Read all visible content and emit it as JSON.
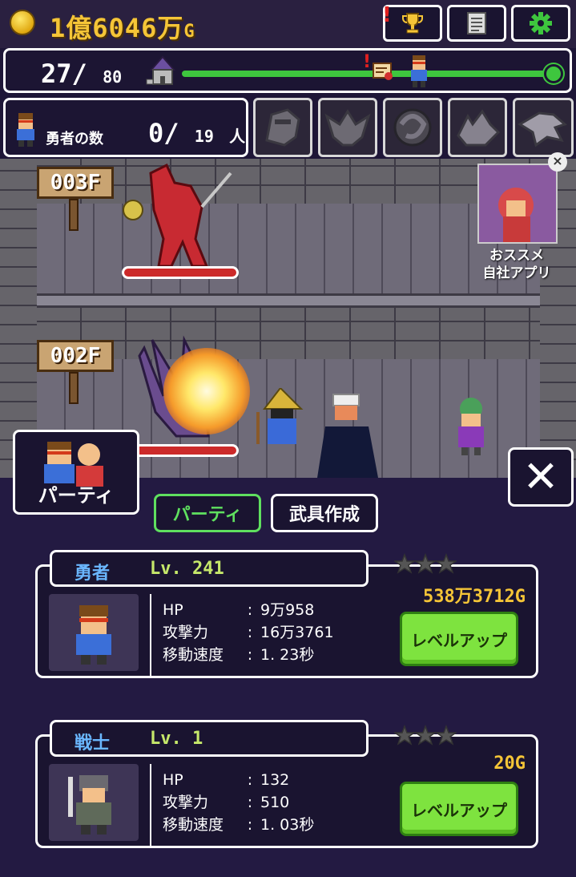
{
  "hud": {
    "gold": "1億6046万",
    "gold_unit": "G",
    "buttons": [
      "trophy",
      "notes",
      "settings"
    ]
  },
  "progress": {
    "current_floor": "27",
    "slash": "/",
    "total_floors": "80",
    "fraction": 0.34
  },
  "heroes": {
    "label": "勇者の数",
    "count": "0",
    "slash": "/",
    "total": "19",
    "unit": "人"
  },
  "boss_icons": [
    "armored-knight-icon",
    "gargoyle-icon",
    "serpent-icon",
    "wolf-icon",
    "eagle-icon"
  ],
  "dungeon": {
    "floors": [
      {
        "label": "003F",
        "enemy_hp": 1.0
      },
      {
        "label": "002F",
        "enemy_hp": 1.0
      }
    ]
  },
  "ad": {
    "label_line1": "おススメ",
    "label_line2": "自社アプリ",
    "close": "×"
  },
  "party_tab": {
    "label": "パーティ"
  },
  "close_button": {
    "label": "✕"
  },
  "tabs": [
    {
      "label": "パーティ",
      "active": true
    },
    {
      "label": "武具作成",
      "active": false
    }
  ],
  "units": [
    {
      "name": "勇者",
      "level": "Lv. 241",
      "cost": "538万3712G",
      "stars": 3,
      "stats": [
        {
          "key": "HP",
          "value": "9万958"
        },
        {
          "key": "攻撃力",
          "value": "16万3761"
        },
        {
          "key": "移動速度",
          "value": "1. 23秒"
        }
      ],
      "button": "レベルアップ"
    },
    {
      "name": "戦士",
      "level": "Lv. 1",
      "cost": "20G",
      "stars": 3,
      "stats": [
        {
          "key": "HP",
          "value": "132"
        },
        {
          "key": "攻撃力",
          "value": "510"
        },
        {
          "key": "移動速度",
          "value": "1. 03秒"
        }
      ],
      "button": "レベルアップ"
    }
  ],
  "colors": {
    "gold": "#f5c537",
    "accent_green": "#5fe05f",
    "name_blue": "#6ab7ff",
    "level_green": "#c6e86a",
    "panel": "#1a1430"
  }
}
